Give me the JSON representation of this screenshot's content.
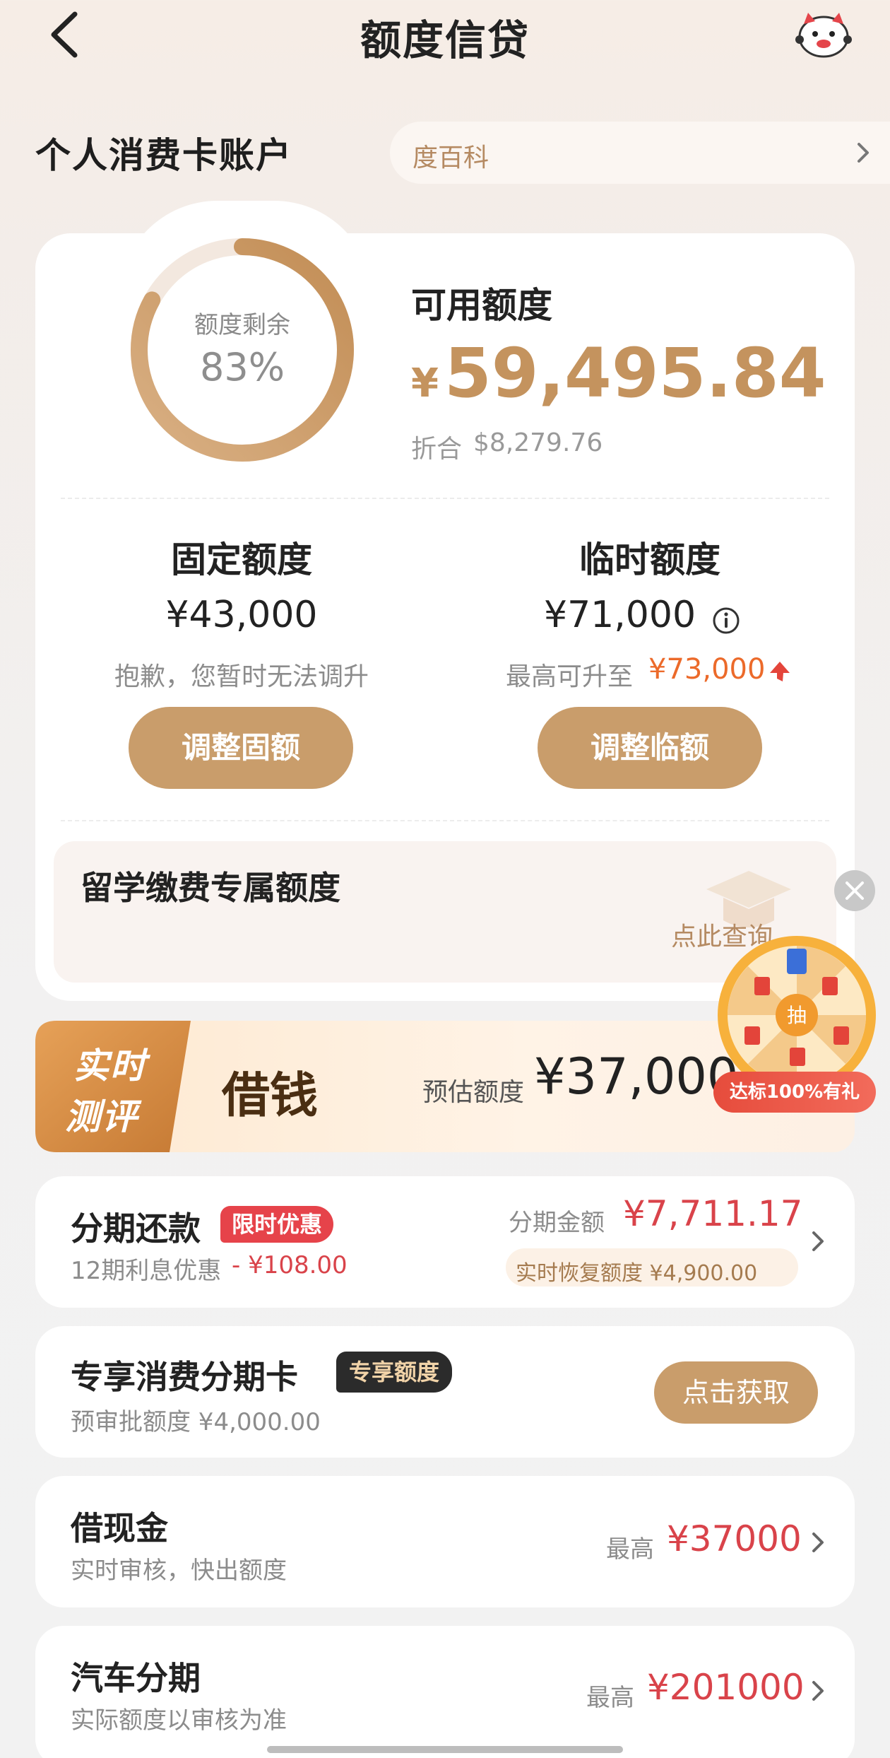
{
  "header": {
    "title": "额度信贷",
    "back_icon": "chevron-left-icon",
    "mascot_icon": "mascot-icon"
  },
  "account": {
    "title": "个人消费卡账户",
    "wiki_text": "度百科"
  },
  "summary": {
    "ring_label": "额度剩余",
    "ring_value": "83%",
    "ring_fraction": 0.83,
    "available_label": "可用额度",
    "currency": "¥",
    "available_amount": "59,495.84",
    "equiv_label": "折合",
    "equiv_value": "$8,279.76",
    "accent_color": "#c4935e"
  },
  "fixed": {
    "title": "固定额度",
    "amount": "¥43,000",
    "note": "抱歉，您暂时无法调升",
    "button": "调整固额"
  },
  "temporary": {
    "title": "临时额度",
    "amount": "¥71,000",
    "note_prefix": "最高可升至",
    "note_value": "¥73,000",
    "button": "调整临额"
  },
  "study": {
    "title": "留学缴费专属额度",
    "link": "点此查询"
  },
  "lucky_wheel": {
    "center": "抽",
    "banner": "达标100%有礼"
  },
  "borrow_banner": {
    "badge_line1": "实时",
    "badge_line2": "测评",
    "title": "借钱",
    "estimate_label": "预估额度",
    "estimate_amount": "¥37,000"
  },
  "installment": {
    "title": "分期还款",
    "badge": "限时优惠",
    "sub_label": "12期利息优惠",
    "sub_value": "- ¥108.00",
    "amount_label": "分期金额",
    "amount_value": "¥7,711.17",
    "recover_text": "实时恢复额度  ¥4,900.00"
  },
  "exclusive_card": {
    "title": "专享消费分期卡",
    "badge": "专享额度",
    "sub": "预审批额度  ¥4,000.00",
    "button": "点击获取"
  },
  "cash_loan": {
    "title": "借现金",
    "sub": "实时审核，快出额度",
    "max_label": "最高",
    "max_value": "¥37000"
  },
  "car_loan": {
    "title": "汽车分期",
    "sub": "实际额度以审核为准",
    "max_label": "最高",
    "max_value": "¥201000"
  }
}
